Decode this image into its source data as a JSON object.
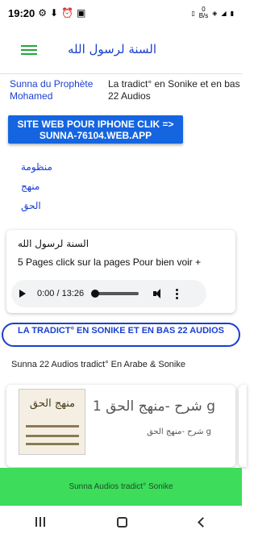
{
  "status_bar": {
    "time": "19:20",
    "net_speed_value": "0",
    "net_speed_unit": "B/s",
    "battery": "▮"
  },
  "app_bar": {
    "title": "السنة لرسول الله"
  },
  "header": {
    "left_text": "Sunna du Prophète Mohamed",
    "right_text": "La tradict° en Sonike et en bas 22 Audios"
  },
  "site_button": {
    "label": "SITE WEB POUR IPHONE CLIK => SUNNA-76104.WEB.APP"
  },
  "links": [
    "منظومة",
    "منهج",
    "الحق"
  ],
  "audio_card": {
    "title": "السنة لرسول الله",
    "subtitle": "5 Pages click sur la pages Pour bien voir +",
    "player_time": "0:00 / 13:26"
  },
  "outline_button": {
    "label": "LA TRADICT° EN SONIKE ET EN BAS 22 AUDIOS"
  },
  "section_label": "Sunna 22 Audios tradict° En Arabe & Sonike",
  "list_item": {
    "thumb_title": "منهج الحق",
    "title": "g شرح -منهج الحق 1",
    "subtitle": "g شرح -منهج الحق"
  },
  "bottom_bar": {
    "label": "Sunna Audios tradict° Sonike"
  },
  "colors": {
    "accent_blue": "#1a3fd0",
    "button_blue": "#1565e0",
    "bottom_green": "#3ddc5a",
    "menu_green": "#22a83a"
  }
}
